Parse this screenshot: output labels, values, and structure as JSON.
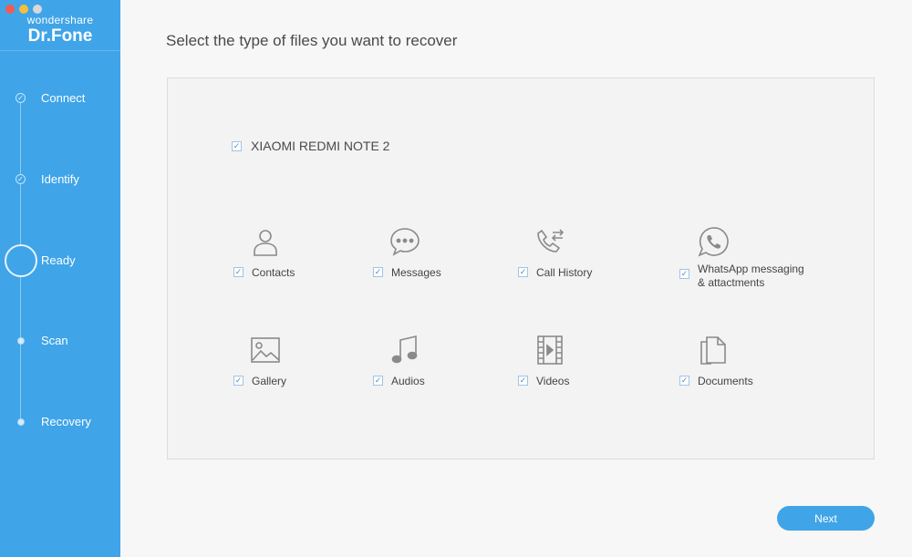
{
  "app": {
    "brand_top": "wondershare",
    "brand_main": "Dr.Fone"
  },
  "steps": [
    {
      "label": "Connect",
      "state": "done"
    },
    {
      "label": "Identify",
      "state": "done"
    },
    {
      "label": "Ready",
      "state": "current"
    },
    {
      "label": "Scan",
      "state": "pending"
    },
    {
      "label": "Recovery",
      "state": "pending"
    }
  ],
  "main": {
    "title": "Select the type of files you want to recover",
    "device": {
      "name": "XIAOMI REDMI NOTE 2",
      "checked": true
    },
    "file_types": [
      {
        "label": "Contacts",
        "icon": "person-icon",
        "checked": true
      },
      {
        "label": "Messages",
        "icon": "chat-bubble-icon",
        "checked": true
      },
      {
        "label": "Call History",
        "icon": "phone-arrows-icon",
        "checked": true
      },
      {
        "label": "WhatsApp messaging\n& attactments",
        "icon": "whatsapp-icon",
        "checked": true
      },
      {
        "label": "Gallery",
        "icon": "image-icon",
        "checked": true
      },
      {
        "label": "Audios",
        "icon": "music-note-icon",
        "checked": true
      },
      {
        "label": "Videos",
        "icon": "film-icon",
        "checked": true
      },
      {
        "label": "Documents",
        "icon": "documents-icon",
        "checked": true
      }
    ],
    "next_label": "Next"
  },
  "colors": {
    "accent": "#3fa4e8",
    "check": "#4a8fd0"
  }
}
